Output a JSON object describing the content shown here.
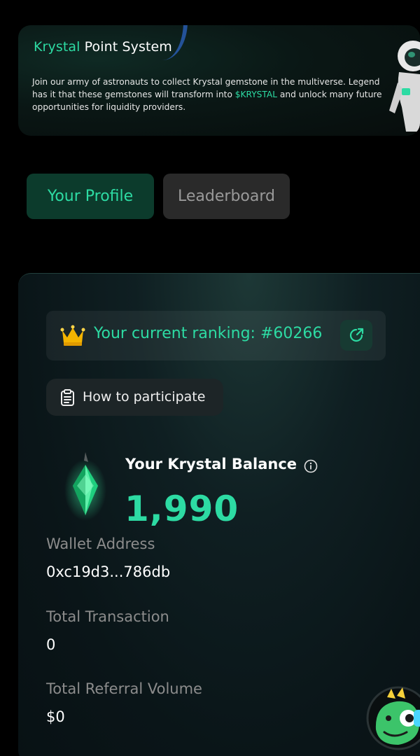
{
  "banner": {
    "title_brand": "Krystal",
    "title_rest": " Point System",
    "description_part1": "Join our army of astronauts to collect Krystal gemstone in the multiverse. Legend has it that these gemstones will transform into ",
    "description_token": "$KRYSTAL",
    "description_part2": " and unlock many future opportunities for liquidity providers."
  },
  "tabs": [
    {
      "label": "Your Profile",
      "active": true
    },
    {
      "label": "Leaderboard",
      "active": false
    }
  ],
  "ranking": {
    "text": "Your current ranking: #60266",
    "icon": "crown-icon",
    "link_icon": "external-link-icon"
  },
  "how_to": {
    "label": "How to participate",
    "icon": "clipboard-icon"
  },
  "balance": {
    "label": "Your Krystal Balance",
    "value": "1,990",
    "icon": "krystal-gem-icon"
  },
  "stats": [
    {
      "label": "Wallet Address",
      "value": "0xc19d3...786db"
    },
    {
      "label": "Total Transaction",
      "value": "0"
    },
    {
      "label": "Total Referral Volume",
      "value": "$0"
    }
  ],
  "colors": {
    "accent": "#2ddba3",
    "background": "#000000",
    "active_tab_bg": "#0c3b2c",
    "inactive_tab_bg": "#2a2a2a"
  }
}
